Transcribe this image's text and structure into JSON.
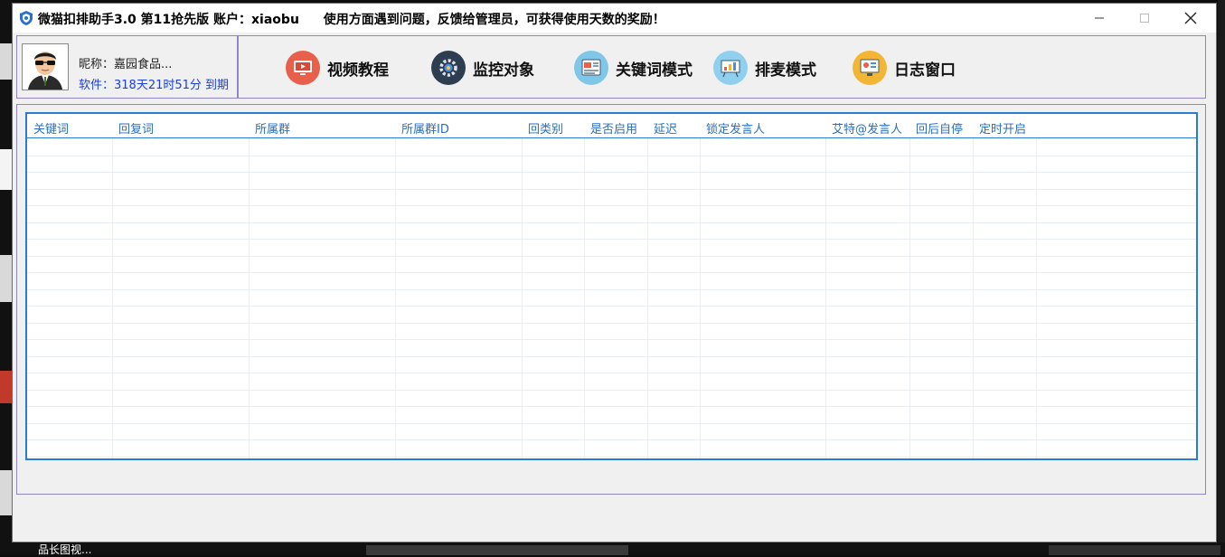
{
  "window": {
    "title": "微猫扣排助手3.0 第11抢先版 账户：xiaobu",
    "notice": "使用方面遇到问题，反馈给管理员，可获得使用天数的奖励！"
  },
  "profile": {
    "nickname": "昵称：嘉园食品...",
    "expiry": "软件：318天21时51分 到期"
  },
  "toolbar": {
    "buttons": [
      {
        "label": "视频教程",
        "icon": "video-tutorial-icon",
        "color": "#e8604c"
      },
      {
        "label": "监控对象",
        "icon": "monitor-gear-icon",
        "color": "#2e3d4f"
      },
      {
        "label": "关键词模式",
        "icon": "keyword-mode-icon",
        "color": "#7fc6e8"
      },
      {
        "label": "排麦模式",
        "icon": "mic-queue-icon",
        "color": "#8fd0ee"
      },
      {
        "label": "日志窗口",
        "icon": "log-window-icon",
        "color": "#f2b634"
      }
    ]
  },
  "table": {
    "columns": [
      "关键词",
      "回复词",
      "所属群",
      "所属群ID",
      "回类别",
      "是否启用",
      "延迟",
      "锁定发言人",
      "艾特@发言人",
      "回后自停",
      "定时开启"
    ],
    "rows": []
  },
  "desktop": {
    "taskbar_label": "品长图视..."
  },
  "colors": {
    "accent_border": "#8f86c8",
    "grid_border": "#2b7bd0",
    "header_text": "#2a6fc0",
    "expiry_text": "#1b3fd8"
  }
}
